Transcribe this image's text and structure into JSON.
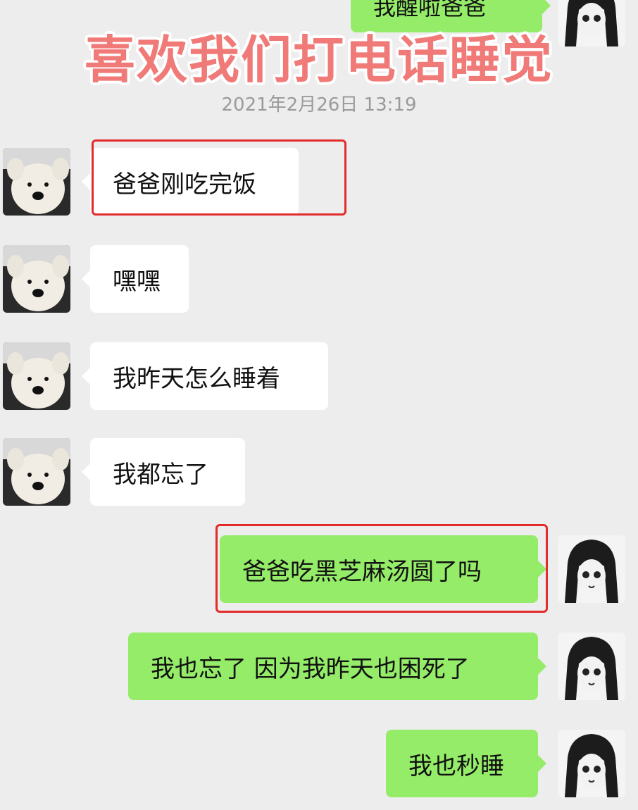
{
  "overlay_title": "喜欢我们打电话睡觉",
  "timestamp": "2021年2月26日 13:19",
  "top_partial_message": "我醒啦爸爸",
  "messages": [
    {
      "side": "in",
      "text": "爸爸刚吃完饭",
      "highlighted": true
    },
    {
      "side": "in",
      "text": "嘿嘿"
    },
    {
      "side": "in",
      "text": "我昨天怎么睡着"
    },
    {
      "side": "in",
      "text": "我都忘了"
    },
    {
      "side": "out",
      "text": "爸爸吃黑芝麻汤圆了吗",
      "highlighted": true
    },
    {
      "side": "out",
      "text": "我也忘了 因为我昨天也困死了"
    },
    {
      "side": "out",
      "text": "我也秒睡"
    }
  ],
  "icons": {
    "incoming_avatar": "dog-avatar-icon",
    "outgoing_avatar": "anime-girl-avatar-icon"
  },
  "colors": {
    "background": "#ededed",
    "incoming_bubble": "#ffffff",
    "outgoing_bubble": "#95ec69",
    "highlight": "#e22b2b",
    "title": "#f07a78"
  }
}
